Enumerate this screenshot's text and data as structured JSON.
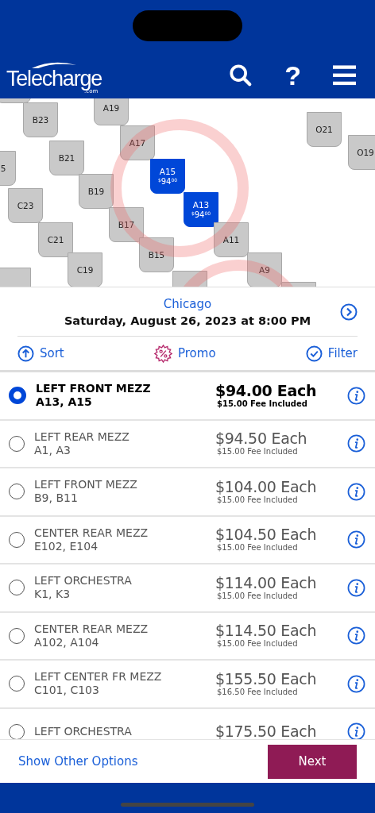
{
  "header": {
    "logo": "Telecharge",
    "logo_suffix": ".com",
    "help": "?"
  },
  "seat_map": {
    "seats": [
      {
        "label": "A19",
        "selected": false
      },
      {
        "label": "B23",
        "selected": false
      },
      {
        "label": "O21",
        "selected": false
      },
      {
        "label": "A17",
        "selected": false
      },
      {
        "label": "O19",
        "selected": false
      },
      {
        "label": "5",
        "selected": false
      },
      {
        "label": "B21",
        "selected": false
      },
      {
        "label": "A15",
        "selected": true,
        "currency": "$",
        "price": "94",
        "cents": "00"
      },
      {
        "label": "B19",
        "selected": false
      },
      {
        "label": "C23",
        "selected": false
      },
      {
        "label": "A13",
        "selected": true,
        "currency": "$",
        "price": "94",
        "cents": "00"
      },
      {
        "label": "B17",
        "selected": false
      },
      {
        "label": "C21",
        "selected": false
      },
      {
        "label": "A11",
        "selected": false
      },
      {
        "label": "B15",
        "selected": false
      },
      {
        "label": "C19",
        "selected": false
      },
      {
        "label": "A9",
        "selected": false
      }
    ]
  },
  "event": {
    "city": "Chicago",
    "datetime": "Saturday, August 26, 2023 at 8:00 PM"
  },
  "actions": [
    {
      "kind": "sort",
      "label": "Sort"
    },
    {
      "kind": "promo",
      "label": "Promo"
    },
    {
      "kind": "filter",
      "label": "Filter"
    }
  ],
  "options": [
    {
      "section": "LEFT FRONT MEZZ",
      "seats": "A13, A15",
      "price": "$94.00 Each",
      "fee": "$15.00 Fee Included",
      "selected": true
    },
    {
      "section": "LEFT REAR MEZZ",
      "seats": "A1, A3",
      "price": "$94.50 Each",
      "fee": "$15.00 Fee Included",
      "selected": false
    },
    {
      "section": "LEFT FRONT MEZZ",
      "seats": "B9, B11",
      "price": "$104.00 Each",
      "fee": "$15.00 Fee Included",
      "selected": false
    },
    {
      "section": "CENTER REAR MEZZ",
      "seats": "E102, E104",
      "price": "$104.50 Each",
      "fee": "$15.00 Fee Included",
      "selected": false
    },
    {
      "section": "LEFT ORCHESTRA",
      "seats": "K1, K3",
      "price": "$114.00 Each",
      "fee": "$15.00 Fee Included",
      "selected": false
    },
    {
      "section": "CENTER REAR MEZZ",
      "seats": "A102, A104",
      "price": "$114.50 Each",
      "fee": "$15.00 Fee Included",
      "selected": false
    },
    {
      "section": "LEFT CENTER FR MEZZ",
      "seats": "C101, C103",
      "price": "$155.50 Each",
      "fee": "$16.50 Fee Included",
      "selected": false
    },
    {
      "section": "LEFT ORCHESTRA",
      "price": "$175.50 Each",
      "selected": false
    }
  ],
  "footer": {
    "link": "Show Other Options",
    "button": "Next"
  }
}
